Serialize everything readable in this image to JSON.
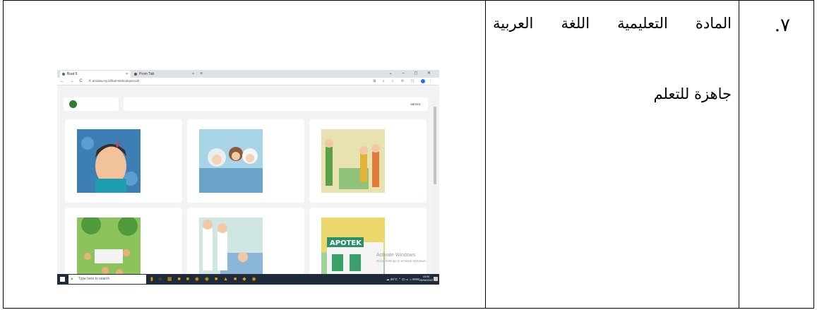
{
  "row": {
    "number": "٧.",
    "line1": "المادة التعليمية اللغة العربية",
    "line2": "جاهزة للتعلم"
  },
  "screenshot": {
    "tabs": [
      {
        "label": "Buat 6",
        "close": "×"
      },
      {
        "label": "Prom Tab",
        "close": "×"
      }
    ],
    "new_tab": "+",
    "window_controls": "⌄ – ◻ ✕",
    "nav": "← → C",
    "url": "Ⓐ amdaw.my.id/bali-6/ebookpencah",
    "user": "admin1",
    "watermark_title": "Activate Windows",
    "watermark_sub": "Go to Settings to activate Windows.",
    "taskbar": {
      "search_placeholder": "Type here to search",
      "apps": "▮ ○ ▦ ■ ■ ◉ ◉ ■ ▲ ■ ◆ ◉",
      "tray": "☁ 26°C  ⌃ ⊡ ▭ ♫ ENG",
      "time": "15:00",
      "date": "26/06/2022"
    },
    "colors": {
      "green_logo": "#2e7d32",
      "taskbar": "#1f2b3a",
      "browser_chrome": "#dee1e6"
    }
  }
}
